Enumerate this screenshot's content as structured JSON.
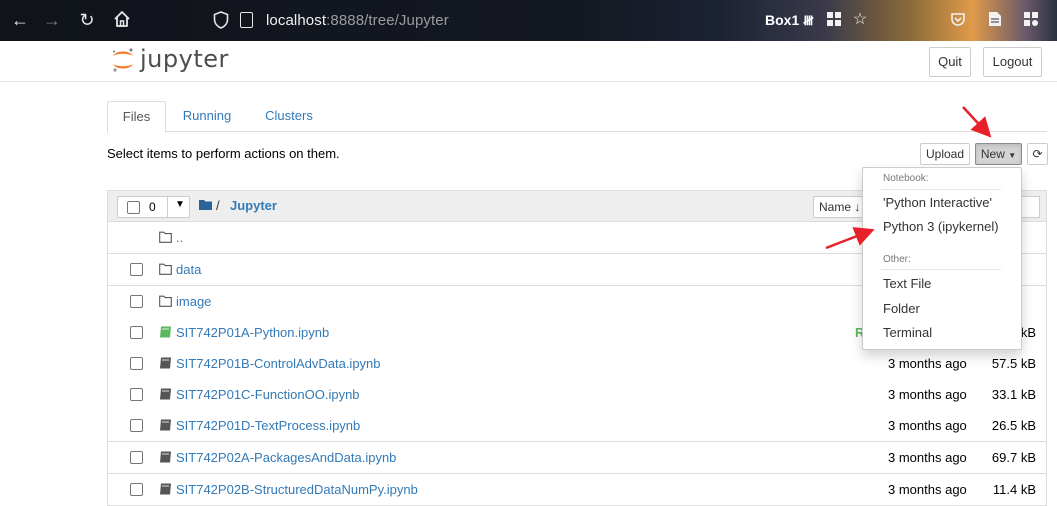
{
  "browser": {
    "url_host": "localhost",
    "url_rest": ":8888/tree/Jupyter",
    "extension_label": "Box1"
  },
  "jupyter": {
    "logo_text": "jupyter",
    "quit_label": "Quit",
    "logout_label": "Logout"
  },
  "tabs": [
    {
      "label": "Files",
      "active": true
    },
    {
      "label": "Running",
      "active": false
    },
    {
      "label": "Clusters",
      "active": false
    }
  ],
  "toolbar": {
    "instruction": "Select items to perform actions on them.",
    "upload_label": "Upload",
    "new_label": "New"
  },
  "list_header": {
    "selected_count": "0",
    "breadcrumb_sep": "/",
    "breadcrumb_dir": "Jupyter",
    "name_sort_label": "Name",
    "size_sort_label": "ze"
  },
  "rows": [
    {
      "type": "parent",
      "name": "..",
      "modified": "",
      "size": "",
      "status": ""
    },
    {
      "type": "folder",
      "name": "data",
      "modified": "",
      "size": "",
      "status": ""
    },
    {
      "type": "folder",
      "name": "image",
      "modified": "",
      "size": "",
      "status": ""
    },
    {
      "type": "notebook-running",
      "name": "SIT742P01A-Python.ipynb",
      "modified": "",
      "size": "kB",
      "status": "R"
    },
    {
      "type": "notebook",
      "name": "SIT742P01B-ControlAdvData.ipynb",
      "modified": "3 months ago",
      "size": "57.5 kB",
      "status": ""
    },
    {
      "type": "notebook",
      "name": "SIT742P01C-FunctionOO.ipynb",
      "modified": "3 months ago",
      "size": "33.1 kB",
      "status": ""
    },
    {
      "type": "notebook",
      "name": "SIT742P01D-TextProcess.ipynb",
      "modified": "3 months ago",
      "size": "26.5 kB",
      "status": ""
    },
    {
      "type": "notebook",
      "name": "SIT742P02A-PackagesAndData.ipynb",
      "modified": "3 months ago",
      "size": "69.7 kB",
      "status": ""
    },
    {
      "type": "notebook",
      "name": "SIT742P02B-StructuredDataNumPy.ipynb",
      "modified": "3 months ago",
      "size": "11.4 kB",
      "status": ""
    }
  ],
  "new_menu": {
    "notebook_header": "Notebook:",
    "notebook_items": [
      "'Python Interactive'",
      "Python 3 (ipykernel)"
    ],
    "other_header": "Other:",
    "other_items": [
      "Text File",
      "Folder",
      "Terminal"
    ]
  },
  "colors": {
    "link": "#337ab7",
    "annotation_arrow": "#e8202a",
    "running": "#5cb85c"
  }
}
